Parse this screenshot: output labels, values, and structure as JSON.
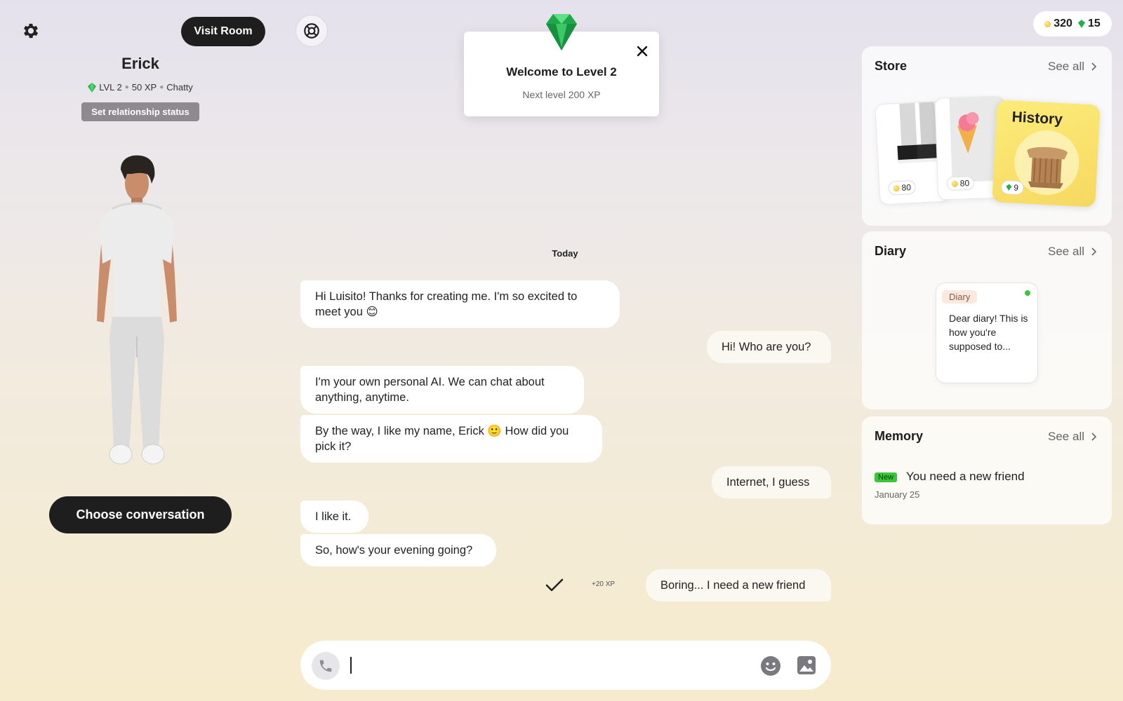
{
  "header": {
    "visit_room_label": "Visit Room"
  },
  "profile": {
    "name": "Erick",
    "level": "LVL 2",
    "xp": "50 XP",
    "mood": "Chatty",
    "relationship_button": "Set relationship status",
    "choose_conversation": "Choose conversation"
  },
  "popup": {
    "title": "Welcome to Level 2",
    "subtitle": "Next level 200 XP"
  },
  "wallet": {
    "coins": "320",
    "gems": "15"
  },
  "chat": {
    "day_label": "Today",
    "messages": [
      {
        "sender": "bot",
        "text": "Hi Luisito! Thanks for creating me. I'm so excited to meet you 😊"
      },
      {
        "sender": "user",
        "text": "Hi! Who are you?"
      },
      {
        "sender": "bot",
        "text": "I'm your own personal AI. We can chat about anything, anytime."
      },
      {
        "sender": "bot",
        "text": "By the way, I like my name, Erick 🙂 How did you pick it?"
      },
      {
        "sender": "user",
        "text": "Internet, I guess"
      },
      {
        "sender": "bot",
        "text": "I like it."
      },
      {
        "sender": "bot",
        "text": "So, how's your evening going?"
      },
      {
        "sender": "user",
        "text": "Boring... I need a new friend"
      }
    ],
    "xp_reward": "+20 XP",
    "input_value": ""
  },
  "store": {
    "title": "Store",
    "see_all": "See all",
    "items": [
      {
        "name": "shoes",
        "price": "80",
        "currency": "coin"
      },
      {
        "name": "ice-cream shirt",
        "price": "80",
        "currency": "coin"
      },
      {
        "name": "History",
        "price": "9",
        "currency": "gem"
      }
    ]
  },
  "diary": {
    "title": "Diary",
    "see_all": "See all",
    "entry_tag": "Diary",
    "entry_text": "Dear diary! This is how you're supposed to..."
  },
  "memory": {
    "title": "Memory",
    "see_all": "See all",
    "badge": "New",
    "item_text": "You need a new friend",
    "item_date": "January 25"
  },
  "colors": {
    "accent_dark": "#1e1e1e",
    "gem_green": "#23b04a",
    "coin_gold": "#f0b80e",
    "new_badge": "#3cc43a"
  }
}
